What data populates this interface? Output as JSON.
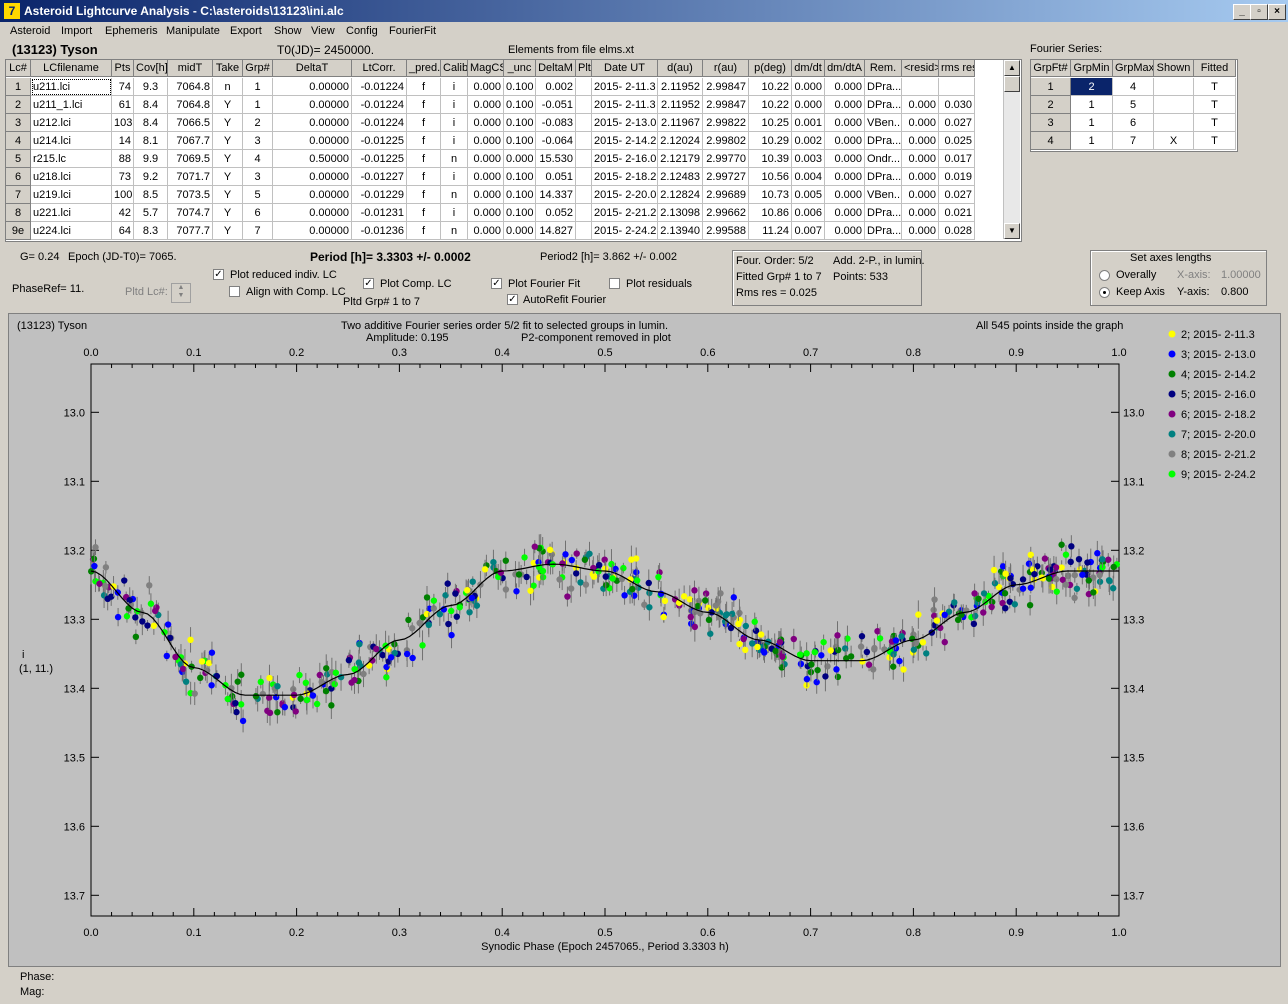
{
  "window": {
    "title": "Asteroid Lightcurve Analysis - C:\\asteroids\\13123\\ini.alc",
    "icon": "app-icon"
  },
  "menu": [
    "Asteroid",
    "Import",
    "Ephemeris",
    "Manipulate",
    "Export",
    "Show",
    "View",
    "Config",
    "FourierFit"
  ],
  "header": {
    "asteroid": "(13123) Tyson",
    "t0": "T0(JD)= 2450000.",
    "elements": "Elements from file elms.xt",
    "fourier_series_label": "Fourier Series:"
  },
  "lc_table": {
    "columns": [
      "Lc#",
      "LCfilename",
      "Pts",
      "Cov[h]",
      "midT",
      "Take",
      "Grp#",
      "DeltaT",
      "LtCorr.",
      "_pred.",
      "Calib.",
      "MagCS",
      "_unc",
      "DeltaM",
      "Plt",
      "Date UT",
      "d(au)",
      "r(au)",
      "p(deg)",
      "dm/dt",
      "dm/dtA",
      "Rem.",
      "<resid>",
      "rms res"
    ],
    "rows": [
      [
        "1",
        "u211.lci",
        "74",
        "9.3",
        "7064.8",
        "n",
        "1",
        "0.00000",
        "-0.01224",
        "f",
        "i",
        "0.000",
        "0.100",
        "0.002",
        "",
        "2015- 2-11.3",
        "2.11952",
        "2.99847",
        "10.22",
        "0.000",
        "0.000",
        "DPra...",
        "",
        ""
      ],
      [
        "2",
        "u211_1.lci",
        "61",
        "8.4",
        "7064.8",
        "Y",
        "1",
        "0.00000",
        "-0.01224",
        "f",
        "i",
        "0.000",
        "0.100",
        "-0.051",
        "",
        "2015- 2-11.3",
        "2.11952",
        "2.99847",
        "10.22",
        "0.000",
        "0.000",
        "DPra...",
        "0.000",
        "0.030"
      ],
      [
        "3",
        "u212.lci",
        "103",
        "8.4",
        "7066.5",
        "Y",
        "2",
        "0.00000",
        "-0.01224",
        "f",
        "i",
        "0.000",
        "0.100",
        "-0.083",
        "",
        "2015- 2-13.0",
        "2.11967",
        "2.99822",
        "10.25",
        "0.001",
        "0.000",
        "VBen...",
        "0.000",
        "0.027"
      ],
      [
        "4",
        "u214.lci",
        "14",
        "8.1",
        "7067.7",
        "Y",
        "3",
        "0.00000",
        "-0.01225",
        "f",
        "i",
        "0.000",
        "0.100",
        "-0.064",
        "",
        "2015- 2-14.2",
        "2.12024",
        "2.99802",
        "10.29",
        "0.002",
        "0.000",
        "DPra...",
        "0.000",
        "0.025"
      ],
      [
        "5",
        "r215.lc",
        "88",
        "9.9",
        "7069.5",
        "Y",
        "4",
        "0.50000",
        "-0.01225",
        "f",
        "n",
        "0.000",
        "0.000",
        "15.530",
        "",
        "2015- 2-16.0",
        "2.12179",
        "2.99770",
        "10.39",
        "0.003",
        "0.000",
        "Ondr...",
        "0.000",
        "0.017"
      ],
      [
        "6",
        "u218.lci",
        "73",
        "9.2",
        "7071.7",
        "Y",
        "3",
        "0.00000",
        "-0.01227",
        "f",
        "i",
        "0.000",
        "0.100",
        "0.051",
        "",
        "2015- 2-18.2",
        "2.12483",
        "2.99727",
        "10.56",
        "0.004",
        "0.000",
        "DPra...",
        "0.000",
        "0.019"
      ],
      [
        "7",
        "u219.lci",
        "100",
        "8.5",
        "7073.5",
        "Y",
        "5",
        "0.00000",
        "-0.01229",
        "f",
        "n",
        "0.000",
        "0.100",
        "14.337",
        "",
        "2015- 2-20.0",
        "2.12824",
        "2.99689",
        "10.73",
        "0.005",
        "0.000",
        "VBen...",
        "0.000",
        "0.027"
      ],
      [
        "8",
        "u221.lci",
        "42",
        "5.7",
        "7074.7",
        "Y",
        "6",
        "0.00000",
        "-0.01231",
        "f",
        "i",
        "0.000",
        "0.100",
        "0.052",
        "",
        "2015- 2-21.2",
        "2.13098",
        "2.99662",
        "10.86",
        "0.006",
        "0.000",
        "DPra...",
        "0.000",
        "0.021"
      ],
      [
        "9e",
        "u224.lci",
        "64",
        "8.3",
        "7077.7",
        "Y",
        "7",
        "0.00000",
        "-0.01236",
        "f",
        "n",
        "0.000",
        "0.000",
        "14.827",
        "",
        "2015- 2-24.2",
        "2.13940",
        "2.99588",
        "11.24",
        "0.007",
        "0.000",
        "DPra...",
        "0.000",
        "0.028"
      ]
    ]
  },
  "fourier_table": {
    "columns": [
      "GrpFt#",
      "GrpMin",
      "GrpMax",
      "Shown",
      "Fitted"
    ],
    "rows": [
      [
        "1",
        "2",
        "4",
        "",
        "T"
      ],
      [
        "2",
        "1",
        "5",
        "",
        "T"
      ],
      [
        "3",
        "1",
        "6",
        "",
        "T"
      ],
      [
        "4",
        "1",
        "7",
        "X",
        "T"
      ]
    ]
  },
  "info": {
    "g": "G= 0.24",
    "epoch": "Epoch (JD-T0)= 7065.",
    "period": "Period [h]= 3.3303 +/- 0.0002",
    "period2": "Period2 [h]= 3.862 +/- 0.002",
    "phaseref": "PhaseRef= 11.",
    "pltd_lc": "Pltd Lc#:",
    "pltd_grp": "Pltd Grp#  1   to   7"
  },
  "checkboxes": {
    "plot_reduced": {
      "label": "Plot reduced indiv. LC",
      "checked": true
    },
    "align_comp": {
      "label": "Align with Comp. LC",
      "checked": false
    },
    "plot_comp": {
      "label": "Plot Comp. LC",
      "checked": true
    },
    "plot_fourier": {
      "label": "Plot Fourier Fit",
      "checked": true
    },
    "plot_residuals": {
      "label": "Plot residuals",
      "checked": false
    },
    "autorefit": {
      "label": "AutoRefit Fourier",
      "checked": true
    }
  },
  "fourier_info": {
    "order": "Four. Order:  5/2",
    "add": "Add. 2-P., in lumin.",
    "fitted": "Fitted Grp# 1 to 7",
    "points": "Points: 533",
    "rms": "Rms res     = 0.025"
  },
  "axes_box": {
    "title": "Set axes lengths",
    "overally": "Overally",
    "keep_axis": "Keep Axis",
    "x_label": "X-axis:",
    "x_value": "1.00000",
    "y_label": "Y-axis:",
    "y_value": "0.800",
    "selected": "keep_axis"
  },
  "plot": {
    "object": "(13123) Tyson",
    "subtitle_line1": "Two additive Fourier series order 5/2 fit to selected groups in lumin.",
    "amplitude": "Amplitude: 0.195",
    "p2_note": "P2-component removed in plot",
    "points_note": "All 545 points inside the graph",
    "ylabel_line1": "i",
    "ylabel_line2": "(1, 11.)"
  },
  "status": {
    "phase": "Phase:",
    "mag": "Mag:"
  },
  "chart_data": {
    "type": "scatter",
    "title": "Two additive Fourier series order 5/2 fit to selected groups in lumin.",
    "xlabel": "Synodic Phase (Epoch 2457065., Period 3.3303 h)",
    "ylabel": "i",
    "xlim": [
      0.0,
      1.0
    ],
    "ylim": [
      12.93,
      13.73
    ],
    "y_inverted": true,
    "x_ticks": [
      "0.0",
      "0.1",
      "0.2",
      "0.3",
      "0.4",
      "0.5",
      "0.6",
      "0.7",
      "0.8",
      "0.9",
      "1.0"
    ],
    "y_ticks": [
      "13.0",
      "13.1",
      "13.2",
      "13.3",
      "13.4",
      "13.5",
      "13.6",
      "13.7"
    ],
    "legend_position": "right",
    "grid": false,
    "series": [
      {
        "name": "2; 2015- 2-11.3",
        "color": "#ffff00"
      },
      {
        "name": "3; 2015- 2-13.0",
        "color": "#0000ff"
      },
      {
        "name": "4; 2015- 2-14.2",
        "color": "#008000"
      },
      {
        "name": "5; 2015- 2-16.0",
        "color": "#000080"
      },
      {
        "name": "6; 2015- 2-18.2",
        "color": "#800080"
      },
      {
        "name": "7; 2015- 2-20.0",
        "color": "#008080"
      },
      {
        "name": "8; 2015- 2-21.2",
        "color": "#808080"
      },
      {
        "name": "9; 2015- 2-24.2",
        "color": "#00ff00"
      }
    ],
    "fit_curve": {
      "color": "#000000",
      "x": [
        0.0,
        0.05,
        0.1,
        0.15,
        0.2,
        0.25,
        0.3,
        0.35,
        0.4,
        0.45,
        0.5,
        0.55,
        0.6,
        0.65,
        0.7,
        0.75,
        0.8,
        0.85,
        0.9,
        0.95,
        1.0
      ],
      "y": [
        13.23,
        13.29,
        13.37,
        13.41,
        13.41,
        13.38,
        13.33,
        13.28,
        13.23,
        13.22,
        13.23,
        13.26,
        13.29,
        13.33,
        13.36,
        13.36,
        13.33,
        13.29,
        13.25,
        13.23,
        13.23
      ]
    }
  }
}
